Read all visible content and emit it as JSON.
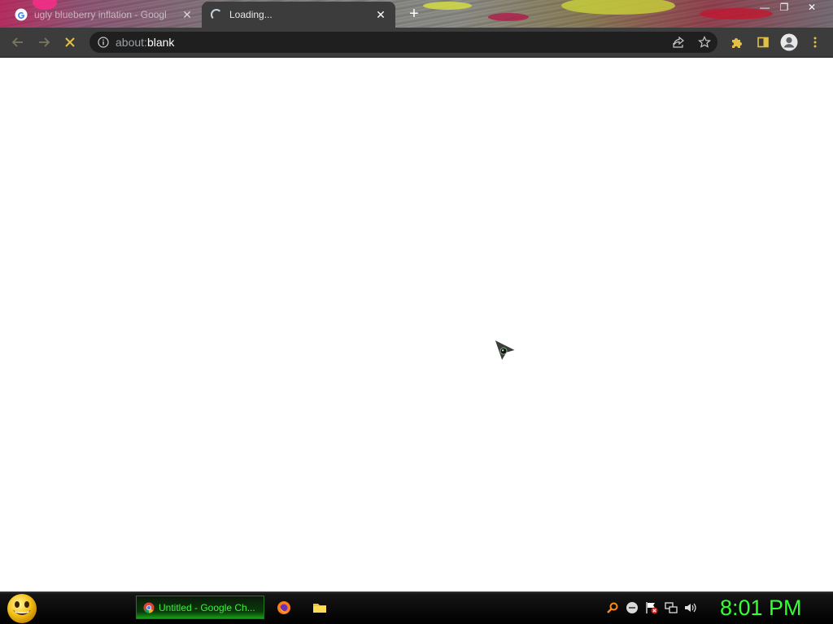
{
  "browser": {
    "tabs": [
      {
        "title": "ugly blueberry inflation - Googl",
        "state": "inactive",
        "icon": "google-g-icon"
      },
      {
        "title": "Loading...",
        "state": "active",
        "icon": "loading-spinner-icon"
      }
    ],
    "address": {
      "prefix": "about:",
      "highlight": "blank"
    },
    "toolbar_icons": [
      "back-arrow-icon",
      "forward-arrow-icon",
      "stop-icon",
      "info-icon",
      "share-icon",
      "star-icon",
      "extensions-puzzle-icon",
      "side-panel-icon",
      "profile-avatar-icon",
      "menu-kebab-icon"
    ]
  },
  "taskbar": {
    "active_task_label": "Untitled - Google Ch...",
    "quick_launch": [
      "firefox-icon",
      "folder-icon"
    ],
    "tray_icons": [
      "search-magnifier-icon",
      "messenger-icon",
      "action-center-flag-icon",
      "network-icon",
      "volume-icon"
    ],
    "clock": "8:01 PM"
  },
  "colors": {
    "toolbar": "#3c3c3c",
    "omnibox": "#1f1f1f",
    "clock": "#33ff33",
    "task_text": "#3cf03c",
    "accent_yellow": "#e2c043"
  }
}
